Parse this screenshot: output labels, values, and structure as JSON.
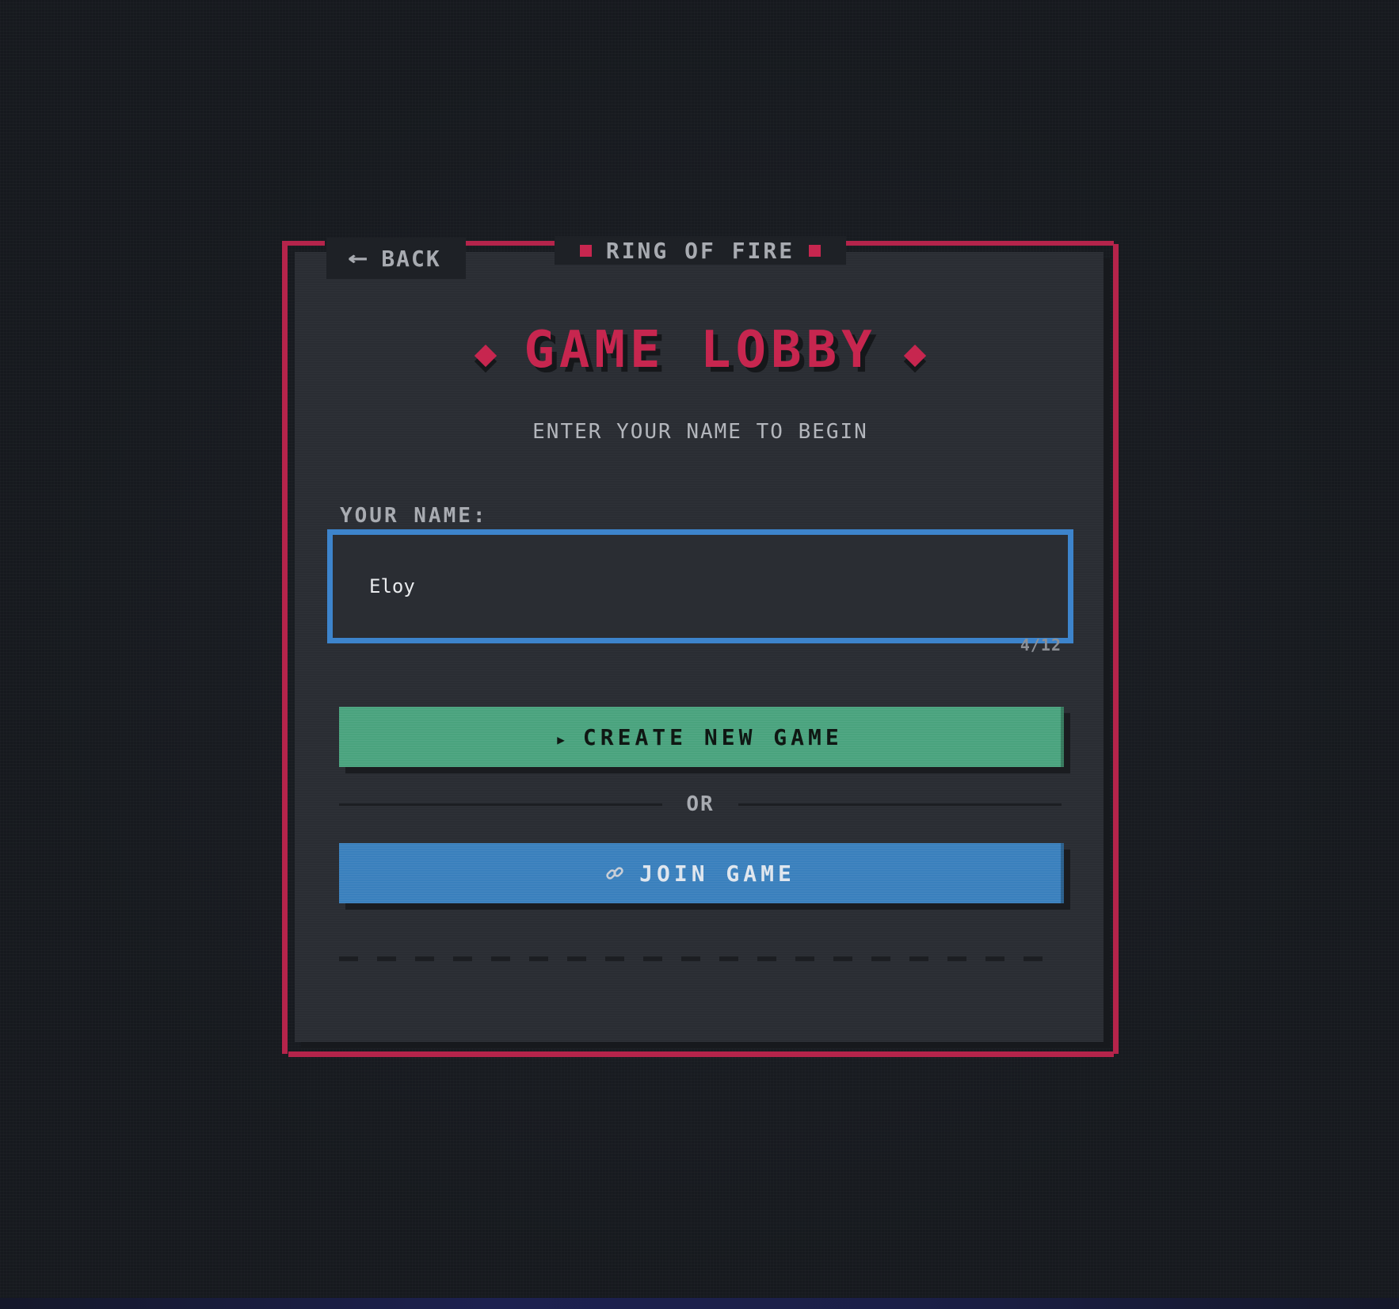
{
  "nav": {
    "back_label": "BACK"
  },
  "header": {
    "tab_title": "RING OF FIRE"
  },
  "main": {
    "heading": "GAME LOBBY",
    "subtitle": "ENTER YOUR NAME TO BEGIN",
    "name_label": "YOUR NAME:",
    "name_value": "Eloy",
    "char_count": "4/12",
    "create_button_label": "CREATE NEW GAME",
    "divider_label": "OR",
    "join_button_label": "JOIN GAME"
  },
  "icons": {
    "back": "arrow-left-icon",
    "create": "play-icon",
    "join": "link-icon",
    "title_decor": "diamond-icon"
  },
  "colors": {
    "accent": "#c7264f",
    "frame": "#b5244b",
    "input_border": "#3d84cc",
    "create_button": "#4aa37e",
    "join_button": "#3a80bd",
    "panel": "#2a2d33",
    "background": "#16191e"
  }
}
